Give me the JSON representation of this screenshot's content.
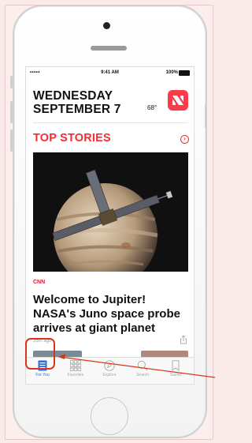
{
  "status_bar": {
    "signal": "•••••",
    "time": "9:41 AM",
    "battery": "100%"
  },
  "header": {
    "day": "WEDNESDAY",
    "date": "SEPTEMBER 7",
    "temperature": "68°"
  },
  "section": {
    "title": "TOP STORIES"
  },
  "story": {
    "source": "CNN",
    "headline": "Welcome to Jupiter! NASA's Juno space probe arrives at giant planet",
    "age": "35m ago"
  },
  "tabs": [
    {
      "label": "For You",
      "icon": "for-you-icon",
      "active": true
    },
    {
      "label": "Favorites",
      "icon": "favorites-grid-icon",
      "active": false
    },
    {
      "label": "Explore",
      "icon": "compass-icon",
      "active": false
    },
    {
      "label": "Search",
      "icon": "search-icon",
      "active": false
    },
    {
      "label": "Saved",
      "icon": "bookmark-icon",
      "active": false
    }
  ],
  "colors": {
    "accent_red": "#f52c35",
    "active_tab_blue": "#2f6fd6",
    "annotation_red": "#d9341d",
    "background_pink": "#fbeaea"
  }
}
